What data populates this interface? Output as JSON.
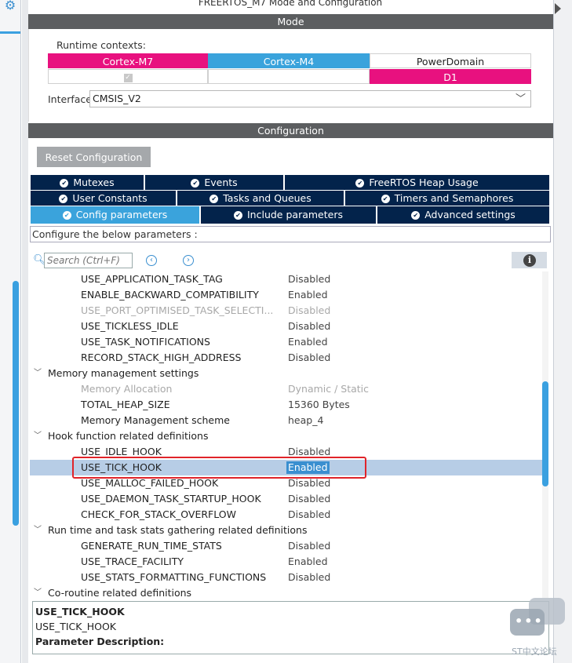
{
  "window": {
    "title": "FREERTOS_M7 Mode and Configuration"
  },
  "mode": {
    "header": "Mode",
    "runtime_label": "Runtime contexts:",
    "contexts": [
      "Cortex-M7",
      "Cortex-M4",
      "PowerDomain"
    ],
    "m7_checked": true,
    "power_domain_value": "D1",
    "interface_label": "Interface",
    "interface_value": "CMSIS_V2"
  },
  "configuration": {
    "header": "Configuration",
    "reset_label": "Reset Configuration",
    "tabs_row1": [
      "Mutexes",
      "Events",
      "FreeRTOS Heap Usage"
    ],
    "tabs_row2": [
      "User Constants",
      "Tasks and Queues",
      "Timers and Semaphores"
    ],
    "tabs_row3": [
      "Config parameters",
      "Include parameters",
      "Advanced settings"
    ],
    "active_tab": "Config parameters",
    "description_line": "Configure the below parameters :",
    "search_placeholder": "Search (Ctrl+F)"
  },
  "tree": {
    "rows": [
      {
        "key": "USE_APPLICATION_TASK_TAG",
        "value": "Disabled"
      },
      {
        "key": "ENABLE_BACKWARD_COMPATIBILITY",
        "value": "Enabled"
      },
      {
        "key": "USE_PORT_OPTIMISED_TASK_SELECTI...",
        "value": "Disabled"
      },
      {
        "key": "USE_TICKLESS_IDLE",
        "value": "Disabled"
      },
      {
        "key": "USE_TASK_NOTIFICATIONS",
        "value": "Enabled"
      },
      {
        "key": "RECORD_STACK_HIGH_ADDRESS",
        "value": "Disabled"
      },
      {
        "group": "Memory management settings"
      },
      {
        "key": "Memory Allocation",
        "value": "Dynamic / Static"
      },
      {
        "key": "TOTAL_HEAP_SIZE",
        "value": "15360 Bytes"
      },
      {
        "key": "Memory Management scheme",
        "value": "heap_4"
      },
      {
        "group": "Hook function related definitions"
      },
      {
        "key": "USE_IDLE_HOOK",
        "value": "Disabled"
      },
      {
        "key": "USE_TICK_HOOK",
        "value": "Enabled"
      },
      {
        "key": "USE_MALLOC_FAILED_HOOK",
        "value": "Disabled"
      },
      {
        "key": "USE_DAEMON_TASK_STARTUP_HOOK",
        "value": "Disabled"
      },
      {
        "key": "CHECK_FOR_STACK_OVERFLOW",
        "value": "Disabled"
      },
      {
        "group": "Run time and task stats gathering related definitions"
      },
      {
        "key": "GENERATE_RUN_TIME_STATS",
        "value": "Disabled"
      },
      {
        "key": "USE_TRACE_FACILITY",
        "value": "Enabled"
      },
      {
        "key": "USE_STATS_FORMATTING_FUNCTIONS",
        "value": "Disabled"
      },
      {
        "group": "Co-routine related definitions"
      }
    ],
    "selected": "USE_TICK_HOOK"
  },
  "description": {
    "title": "USE_TICK_HOOK",
    "name": "USE_TICK_HOOK",
    "param_label": "Parameter Description:"
  },
  "watermark": {
    "text": "ST中文论坛"
  },
  "colors": {
    "magenta": "#e8117f",
    "blue": "#3aa3dc",
    "navy": "#03234b",
    "highlight": "#e0242a"
  }
}
